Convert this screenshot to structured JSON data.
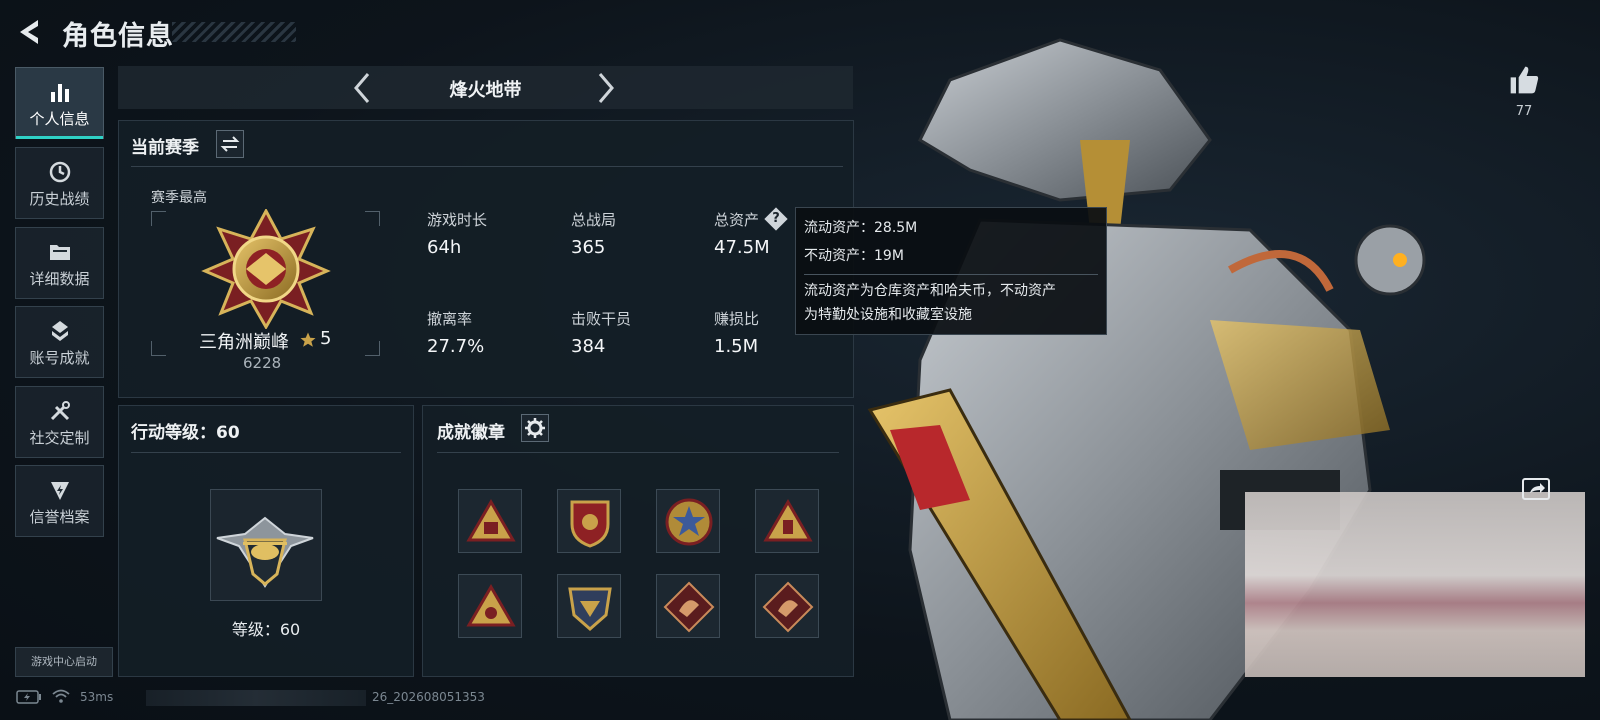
{
  "header": {
    "title": "角色信息",
    "back_icon": "back-arrow-icon"
  },
  "sidebar": {
    "items": [
      {
        "label": "个人信息",
        "icon": "bar-chart-icon",
        "active": true
      },
      {
        "label": "历史战绩",
        "icon": "history-clock-icon"
      },
      {
        "label": "详细数据",
        "icon": "folder-icon"
      },
      {
        "label": "账号成就",
        "icon": "achievement-icon"
      },
      {
        "label": "社交定制",
        "icon": "tools-icon"
      },
      {
        "label": "信誉档案",
        "icon": "credit-shield-icon"
      }
    ],
    "launch_label": "游戏中心启动"
  },
  "tabbar": {
    "title": "烽火地带",
    "prev_icon": "chevron-left-icon",
    "next_icon": "chevron-right-icon"
  },
  "season": {
    "title": "当前赛季",
    "switch_icon": "swap-icon",
    "best_label": "赛季最高",
    "rank_name": "三角洲巅峰",
    "rank_stars": "5",
    "rank_score": "6228",
    "stats": [
      {
        "label": "游戏时长",
        "value": "64h"
      },
      {
        "label": "总战局",
        "value": "365"
      },
      {
        "label": "总资产",
        "value": "47.5M",
        "help": "?"
      },
      {
        "label": "撤离率",
        "value": "27.7%"
      },
      {
        "label": "击败干员",
        "value": "384"
      },
      {
        "label": "赚损比",
        "value": "1.5M"
      }
    ]
  },
  "tooltip": {
    "line1": "流动资产：28.5M",
    "line2": "不动资产：19M",
    "desc1": "流动资产为仓库资产和哈夫币，不动资产",
    "desc2": "为特勤处设施和收藏室设施"
  },
  "action_level": {
    "title": "行动等级：60",
    "level_text": "等级：60"
  },
  "achievements": {
    "title": "成就徽章",
    "settings_icon": "gear-icon",
    "badges": [
      "triangle-badge-icon",
      "shield-badge-icon",
      "star-badge-icon",
      "triangle-badge-icon",
      "triangle-badge-icon",
      "crest-badge-icon",
      "dragon-badge-icon",
      "dragon-badge-icon"
    ]
  },
  "right": {
    "like_icon": "thumbs-up-icon",
    "like_count": "77",
    "share_icon": "share-icon"
  },
  "status_bar": {
    "ping": "53ms",
    "build": "26_202608051353"
  },
  "colors": {
    "accent": "#2fd1c6",
    "gold": "#c9a24a",
    "panel": "#141e26"
  }
}
